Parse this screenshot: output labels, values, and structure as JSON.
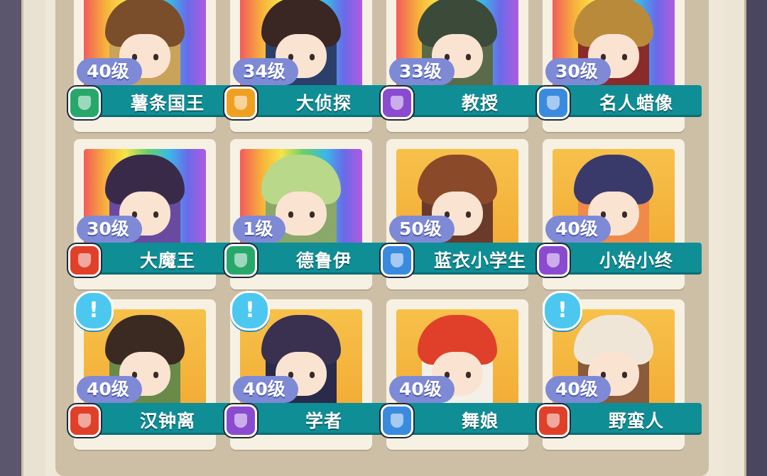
{
  "cards": [
    {
      "level": "40级",
      "name": "薯条国王",
      "badge_color": "#27a86a",
      "bg": "rainbow",
      "hair": "#7a4e2a",
      "body": "#c9a35a",
      "alert": false
    },
    {
      "level": "34级",
      "name": "大侦探",
      "badge_color": "#f0a020",
      "bg": "rainbow",
      "hair": "#3a2622",
      "body": "#2c3e6a",
      "alert": false
    },
    {
      "level": "33级",
      "name": "教授",
      "badge_color": "#8a4bd0",
      "bg": "rainbow",
      "hair": "#3c4a3a",
      "body": "#5a6b4a",
      "alert": false
    },
    {
      "level": "30级",
      "name": "名人蜡像",
      "badge_color": "#3a8ae0",
      "bg": "rainbow",
      "hair": "#b98a3a",
      "body": "#8a2a2a",
      "alert": false
    },
    {
      "level": "30级",
      "name": "大魔王",
      "badge_color": "#e0402a",
      "bg": "rainbow",
      "hair": "#3a2a4a",
      "body": "#6a4aa0",
      "alert": false
    },
    {
      "level": "1级",
      "name": "德鲁伊",
      "badge_color": "#27a86a",
      "bg": "rainbow",
      "hair": "#b9d88a",
      "body": "#8aa86a",
      "alert": false
    },
    {
      "level": "50级",
      "name": "蓝衣小学生",
      "badge_color": "#3a8ae0",
      "bg": "gold",
      "hair": "#8a4a2a",
      "body": "#6a3a2a",
      "alert": false
    },
    {
      "level": "40级",
      "name": "小始小终",
      "badge_color": "#8a4bd0",
      "bg": "gold",
      "hair": "#3a3a6a",
      "body": "#f08a4a",
      "alert": false
    },
    {
      "level": "40级",
      "name": "汉钟离",
      "badge_color": "#e0402a",
      "bg": "gold",
      "hair": "#3a2a22",
      "body": "#6a8a4a",
      "alert": true
    },
    {
      "level": "40级",
      "name": "学者",
      "badge_color": "#8a4bd0",
      "bg": "gold",
      "hair": "#3a3050",
      "body": "#2a2a4a",
      "alert": true
    },
    {
      "level": "40级",
      "name": "舞娘",
      "badge_color": "#3a8ae0",
      "bg": "gold",
      "hair": "#e0402a",
      "body": "#f4f0e8",
      "alert": false
    },
    {
      "level": "40级",
      "name": "野蛮人",
      "badge_color": "#e0402a",
      "bg": "gold",
      "hair": "#f0e6d8",
      "body": "#8a5a3a",
      "alert": true
    }
  ],
  "icons": {
    "alert": "exclamation-bubble-icon",
    "badge": "rank-shield-icon"
  },
  "alert_glyph": "!"
}
